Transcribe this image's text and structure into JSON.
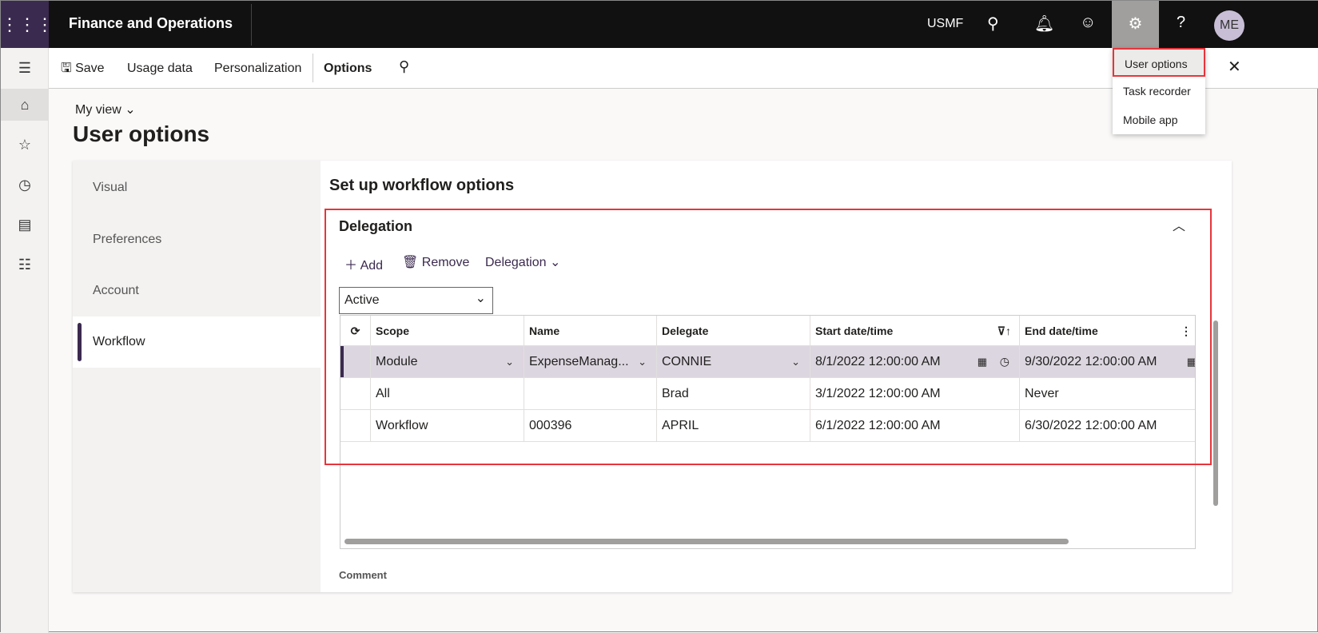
{
  "header": {
    "app_title": "Finance and Operations",
    "company": "USMF",
    "avatar_initials": "ME"
  },
  "settings_menu": {
    "items": [
      "User options",
      "Task recorder",
      "Mobile app"
    ]
  },
  "toolbar": {
    "save": "Save",
    "usage_data": "Usage data",
    "personalization": "Personalization",
    "options": "Options"
  },
  "page": {
    "view": "My view",
    "title": "User options"
  },
  "tabs": [
    "Visual",
    "Preferences",
    "Account",
    "Workflow"
  ],
  "section": {
    "title": "Set up workflow options",
    "group": "Delegation",
    "add": "Add",
    "remove": "Remove",
    "delegation_menu": "Delegation",
    "filter_value": "Active",
    "comment_label": "Comment"
  },
  "grid": {
    "columns": [
      "Scope",
      "Name",
      "Delegate",
      "Start date/time",
      "End date/time"
    ],
    "rows": [
      [
        "Module",
        "ExpenseManag...",
        "CONNIE",
        "8/1/2022 12:00:00 AM",
        "9/30/2022 12:00:00 AM"
      ],
      [
        "All",
        "",
        "Brad",
        "3/1/2022 12:00:00 AM",
        "Never"
      ],
      [
        "Workflow",
        "000396",
        "APRIL",
        "6/1/2022 12:00:00 AM",
        "6/30/2022 12:00:00 AM"
      ]
    ]
  },
  "colors": {
    "accent": "#3b2a4f",
    "highlight": "#e8343b",
    "selected_row": "#dcd6e0"
  }
}
